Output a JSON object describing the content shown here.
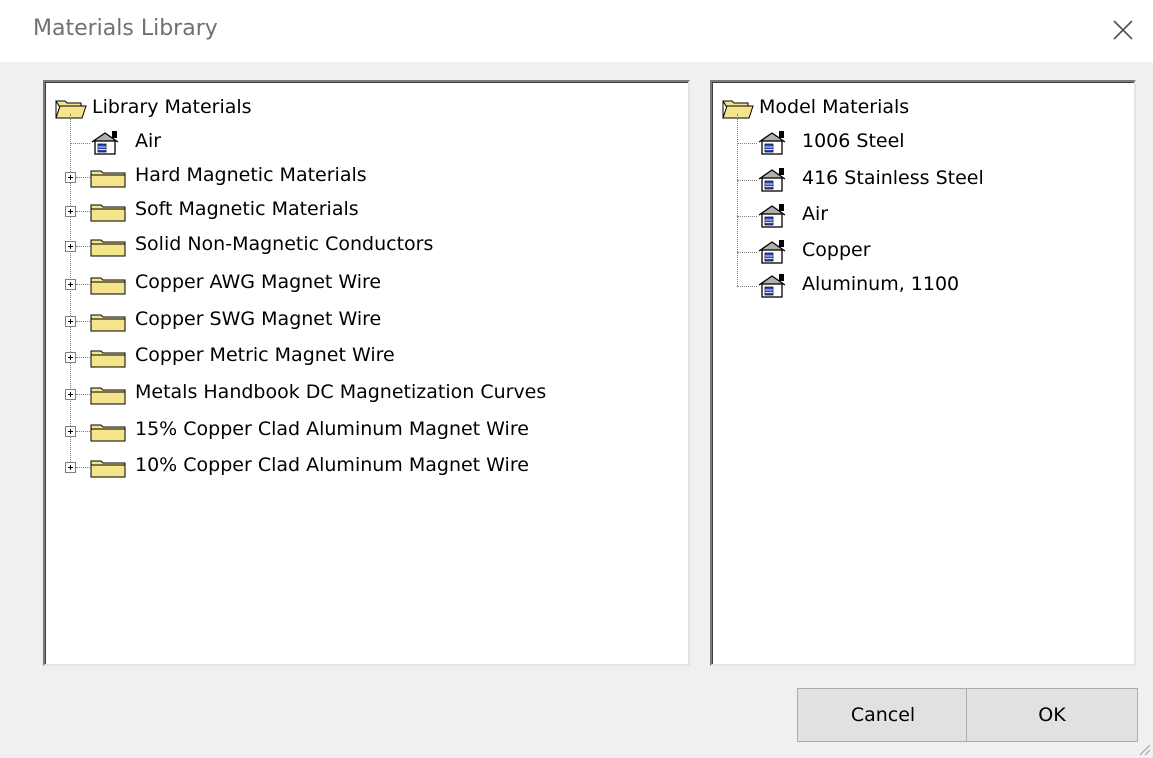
{
  "window": {
    "title": "Materials Library"
  },
  "library": {
    "root_label": "Library Materials",
    "items": [
      {
        "label": "Air",
        "kind": "material"
      },
      {
        "label": "Hard Magnetic Materials",
        "kind": "folder"
      },
      {
        "label": "Soft Magnetic Materials",
        "kind": "folder"
      },
      {
        "label": "Solid Non-Magnetic Conductors",
        "kind": "folder"
      },
      {
        "label": "Copper AWG Magnet Wire",
        "kind": "folder"
      },
      {
        "label": "Copper SWG Magnet Wire",
        "kind": "folder"
      },
      {
        "label": "Copper Metric Magnet Wire",
        "kind": "folder"
      },
      {
        "label": "Metals Handbook DC Magnetization Curves",
        "kind": "folder"
      },
      {
        "label": "15% Copper Clad Aluminum Magnet Wire",
        "kind": "folder"
      },
      {
        "label": "10% Copper Clad Aluminum Magnet Wire",
        "kind": "folder"
      }
    ]
  },
  "model": {
    "root_label": "Model Materials",
    "items": [
      {
        "label": "1006 Steel",
        "kind": "material"
      },
      {
        "label": "416 Stainless Steel",
        "kind": "material"
      },
      {
        "label": "Air",
        "kind": "material"
      },
      {
        "label": "Copper",
        "kind": "material"
      },
      {
        "label": "Aluminum, 1100",
        "kind": "material"
      }
    ]
  },
  "buttons": {
    "cancel_label": "Cancel",
    "ok_label": "OK"
  },
  "icons": {
    "open_folder": "open-folder-icon",
    "folder": "folder-icon",
    "material": "material-icon",
    "expand": "plus-expander-icon",
    "close": "close-icon"
  },
  "colors": {
    "folder_yellow": "#f4e48c",
    "panel_bg": "#ffffff",
    "dialog_bg": "#f0f0f0",
    "button_bg": "#e1e1e1"
  }
}
